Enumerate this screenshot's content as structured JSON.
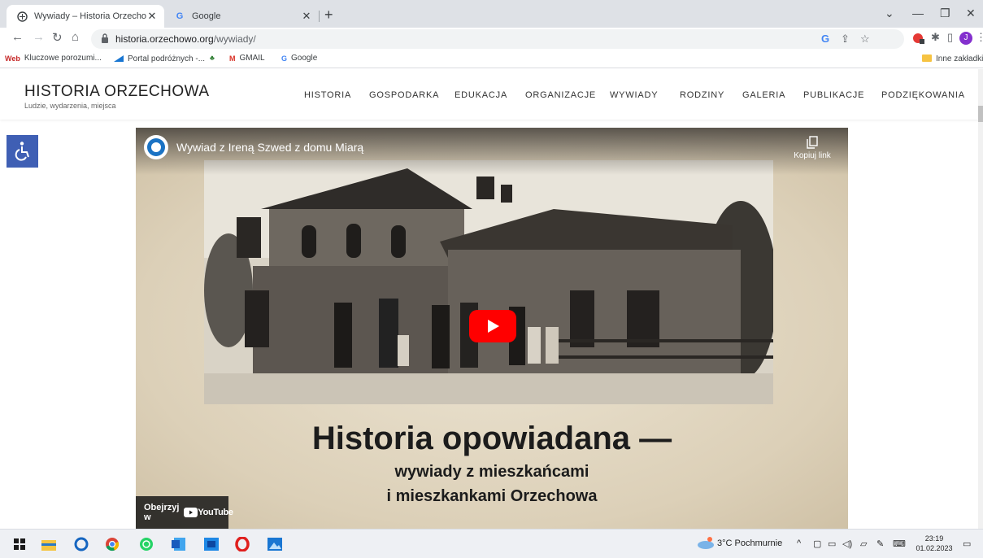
{
  "browser": {
    "tabs": [
      {
        "title": "Wywiady – Historia Orzechowa",
        "active": true
      },
      {
        "title": "Google",
        "active": false
      }
    ],
    "new_tab_label": "+",
    "url_host": "historia.orzechowo.org",
    "url_path": "/wywiady/",
    "profile_initial": "J",
    "colors": {
      "tabstrip": "#dee1e6",
      "profile": "#8430ce"
    }
  },
  "bookmarks": [
    {
      "label": "Kluczowe porozumi...",
      "icon": "web-icon"
    },
    {
      "label": "Portal podróżnych -...",
      "icon": "portal-icon"
    },
    {
      "label": "",
      "icon": "tree-icon"
    },
    {
      "label": "GMAIL",
      "icon": "gmail-icon"
    },
    {
      "label": "Google",
      "icon": "google-icon"
    }
  ],
  "bookmarks_other": "Inne zakładki",
  "site": {
    "title": "HISTORIA ORZECHOWA",
    "tagline": "Ludzie, wydarzenia, miejsca",
    "menu": [
      "HISTORIA",
      "GOSPODARKA",
      "EDUKACJA",
      "ORGANIZACJE",
      "WYWIADY",
      "RODZINY",
      "GALERIA",
      "PUBLIKACJE",
      "PODZIĘKOWANIA"
    ]
  },
  "video": {
    "title": "Wywiad z Ireną Szwed z domu Miarą",
    "copy_link": "Kopiuj link",
    "headline": "Historia opowiadana —",
    "subline1": "wywiady z mieszkańcami",
    "subline2": "i mieszkankami Orzechowa",
    "watch_on": "Obejrzyj w",
    "youtube": "YouTube",
    "play_color": "#ff0000"
  },
  "taskbar": {
    "weather": "3°C Pochmurnie",
    "time": "23:19",
    "date": "01.02.2023"
  }
}
